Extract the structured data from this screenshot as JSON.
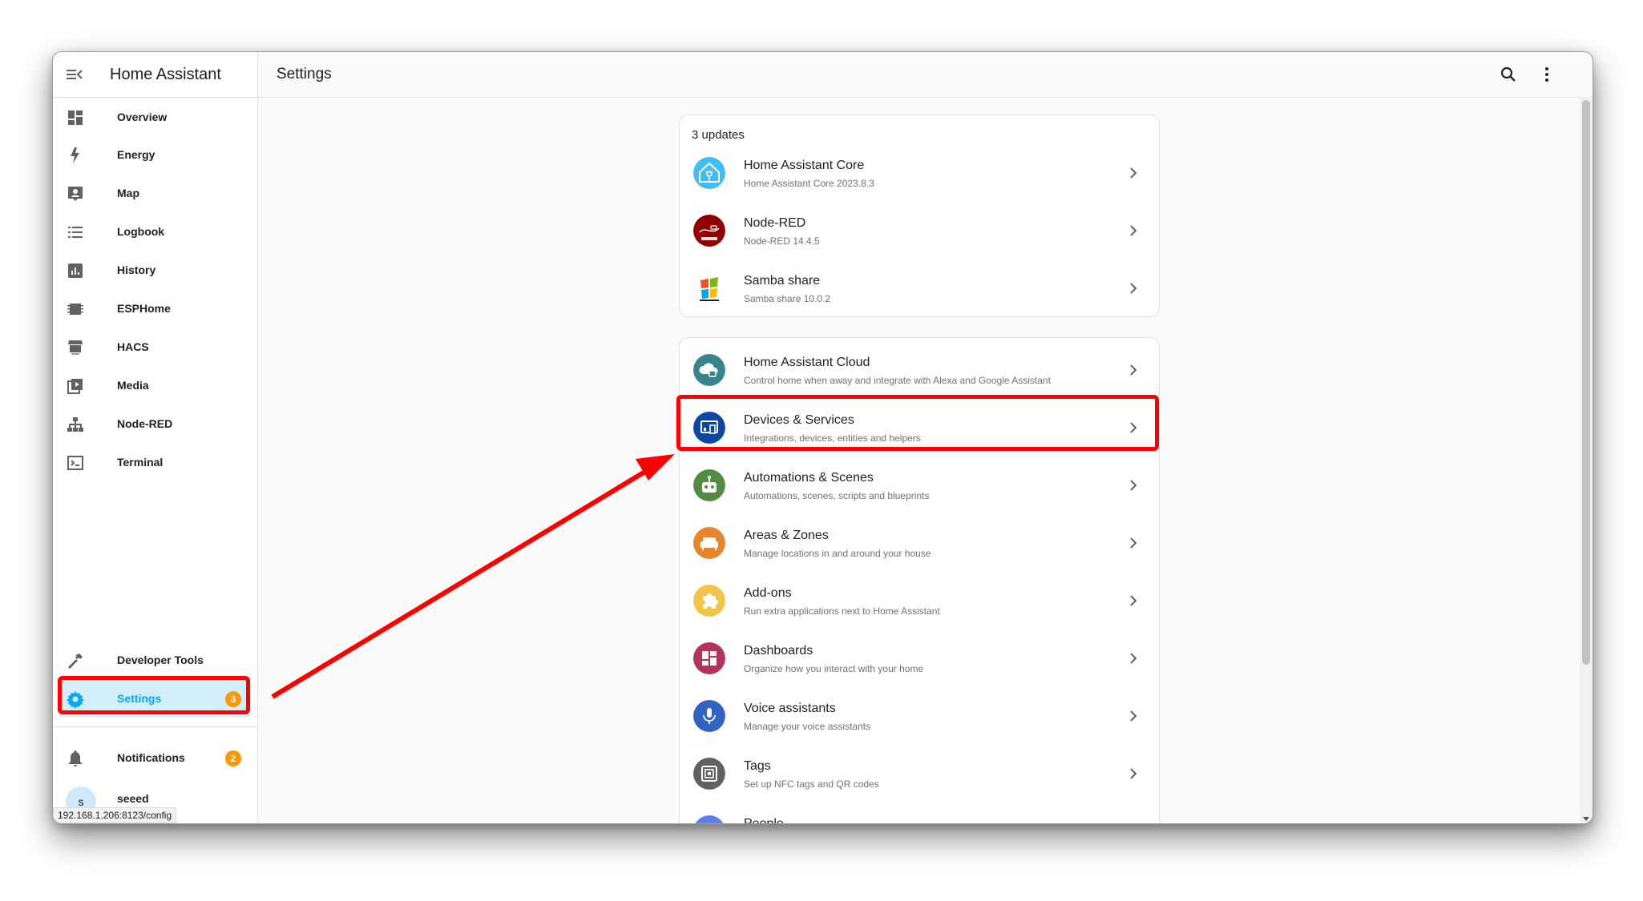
{
  "sidebar": {
    "title": "Home Assistant",
    "items": [
      {
        "label": "Overview",
        "icon": "overview-icon"
      },
      {
        "label": "Energy",
        "icon": "energy-icon"
      },
      {
        "label": "Map",
        "icon": "map-icon"
      },
      {
        "label": "Logbook",
        "icon": "logbook-icon"
      },
      {
        "label": "History",
        "icon": "history-icon"
      },
      {
        "label": "ESPHome",
        "icon": "esphome-icon"
      },
      {
        "label": "HACS",
        "icon": "hacs-icon"
      },
      {
        "label": "Media",
        "icon": "media-icon"
      },
      {
        "label": "Node-RED",
        "icon": "node-red-icon"
      },
      {
        "label": "Terminal",
        "icon": "terminal-icon"
      }
    ],
    "developer_tools": "Developer Tools",
    "settings": {
      "label": "Settings",
      "badge": "3"
    },
    "notifications": {
      "label": "Notifications",
      "badge": "2"
    },
    "user": {
      "initial": "s",
      "name": "seeed"
    },
    "status_url": "192.168.1.206:8123/config"
  },
  "topbar": {
    "title": "Settings"
  },
  "updates": {
    "heading": "3 updates",
    "items": [
      {
        "title": "Home Assistant Core",
        "subtitle": "Home Assistant Core 2023.8.3"
      },
      {
        "title": "Node-RED",
        "subtitle": "Node-RED 14.4.5"
      },
      {
        "title": "Samba share",
        "subtitle": "Samba share 10.0.2"
      }
    ]
  },
  "settings_menu": [
    {
      "title": "Home Assistant Cloud",
      "subtitle": "Control home when away and integrate with Alexa and Google Assistant",
      "color": "#37838e"
    },
    {
      "title": "Devices & Services",
      "subtitle": "Integrations, devices, entities and helpers",
      "color": "#0d47a1"
    },
    {
      "title": "Automations & Scenes",
      "subtitle": "Automations, scenes, scripts and blueprints",
      "color": "#518c43"
    },
    {
      "title": "Areas & Zones",
      "subtitle": "Manage locations in and around your house",
      "color": "#e48629"
    },
    {
      "title": "Add-ons",
      "subtitle": "Run extra applications next to Home Assistant",
      "color": "#f1c447"
    },
    {
      "title": "Dashboards",
      "subtitle": "Organize how you interact with your home",
      "color": "#b1345c"
    },
    {
      "title": "Voice assistants",
      "subtitle": "Manage your voice assistants",
      "color": "#3263c3"
    },
    {
      "title": "Tags",
      "subtitle": "Set up NFC tags and QR codes",
      "color": "#616161"
    },
    {
      "title": "People",
      "subtitle": "",
      "color": "#5c7cf0"
    }
  ],
  "colors": {
    "accent": "#03a9f4",
    "badge": "#ff9800",
    "annotation": "#ff0000"
  }
}
